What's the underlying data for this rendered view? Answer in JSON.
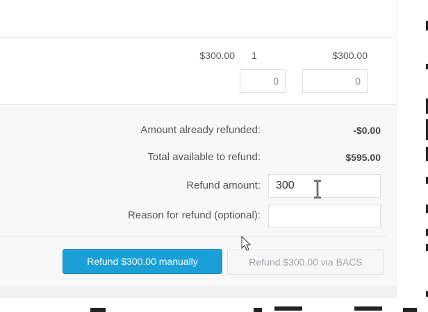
{
  "line_item": {
    "unit_price": "$300.00",
    "quantity": "1",
    "line_total": "$300.00",
    "refund_qty_value": "0",
    "refund_total_value": "0"
  },
  "refund": {
    "already_refunded_label": "Amount already refunded:",
    "already_refunded_value": "-$0.00",
    "available_label": "Total available to refund:",
    "available_value": "$595.00",
    "amount_label": "Refund amount:",
    "amount_value": "300",
    "reason_label": "Reason for refund (optional):",
    "reason_value": ""
  },
  "buttons": {
    "manual_label": "Refund $300.00 manually",
    "gateway_label": "Refund $300.00 via BACS"
  },
  "colors": {
    "primary_button": "#1aa0d7",
    "panel_bg": "#f8f8f8"
  }
}
